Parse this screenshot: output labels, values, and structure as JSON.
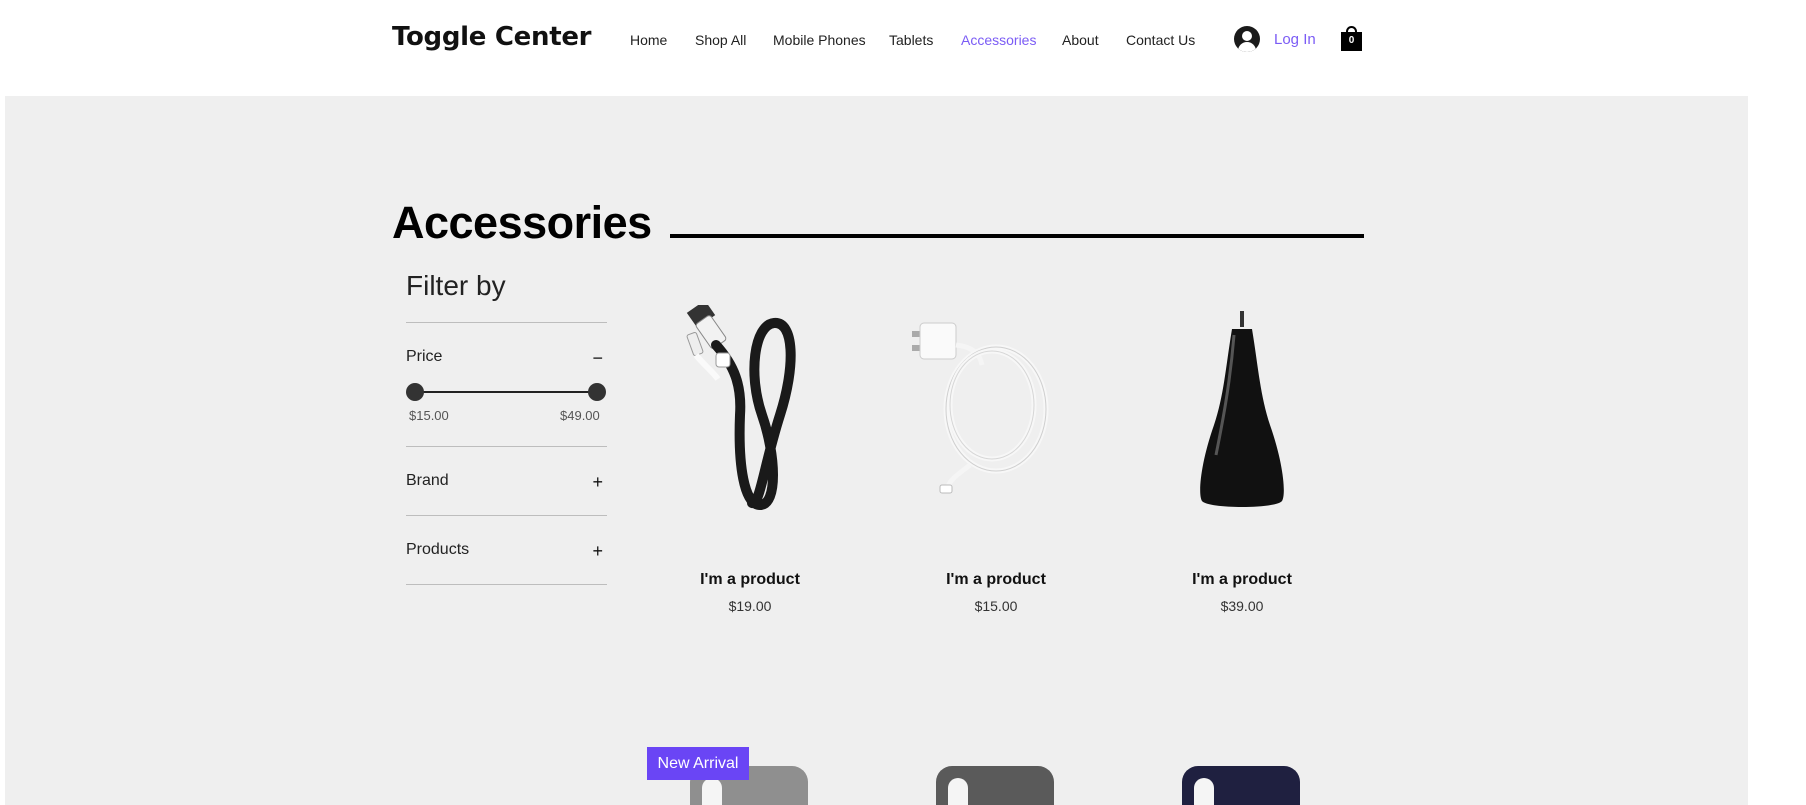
{
  "header": {
    "brand": "Toggle Center",
    "nav": [
      {
        "label": "Home",
        "active": false
      },
      {
        "label": "Shop All",
        "active": false
      },
      {
        "label": "Mobile Phones",
        "active": false
      },
      {
        "label": "Tablets",
        "active": false
      },
      {
        "label": "Accessories",
        "active": true
      },
      {
        "label": "About",
        "active": false
      },
      {
        "label": "Contact Us",
        "active": false
      }
    ],
    "login_label": "Log In",
    "cart_count": "0",
    "accent_color": "#7b5cf5"
  },
  "page": {
    "title": "Accessories"
  },
  "filter": {
    "title": "Filter by",
    "price": {
      "label": "Price",
      "toggle": "−",
      "min_label": "$15.00",
      "max_label": "$49.00"
    },
    "brand": {
      "label": "Brand",
      "toggle": "+"
    },
    "products": {
      "label": "Products",
      "toggle": "+"
    }
  },
  "products": [
    {
      "name": "I'm a product",
      "price": "$19.00",
      "image": "usb-lightning-cable-icon"
    },
    {
      "name": "I'm a product",
      "price": "$15.00",
      "image": "wall-charger-cable-icon"
    },
    {
      "name": "I'm a product",
      "price": "$39.00",
      "image": "car-charger-icon"
    }
  ],
  "second_row": {
    "badge": "New Arrival",
    "badge_color": "#6a45f5",
    "case_colors": [
      "#8f8f8f",
      "#5a5a5a",
      "#1f2040"
    ]
  }
}
